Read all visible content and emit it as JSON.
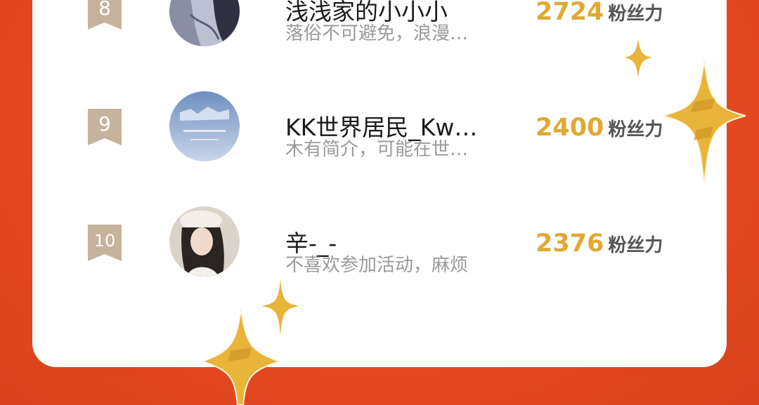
{
  "ranking": {
    "entries": [
      {
        "rank": "8",
        "name": "浅浅家的小小小",
        "bio": "落俗不可避免，浪漫…",
        "score": "2724",
        "unit": "粉丝力"
      },
      {
        "rank": "9",
        "name": "KK世界居民_Kw…",
        "bio": "木有简介，可能在世…",
        "score": "2400",
        "unit": "粉丝力"
      },
      {
        "rank": "10",
        "name": "辛-_-",
        "bio": "不喜欢参加活动，麻烦",
        "score": "2376",
        "unit": "粉丝力"
      }
    ]
  },
  "colors": {
    "background": "#e64b22",
    "card": "#ffffff",
    "score": "#e0a933",
    "badge": "#c5b39c",
    "sparkle": "#e8b43a"
  },
  "icons": {
    "rank_badge": "ribbon-badge-icon",
    "sparkle": "sparkle-star-icon"
  }
}
